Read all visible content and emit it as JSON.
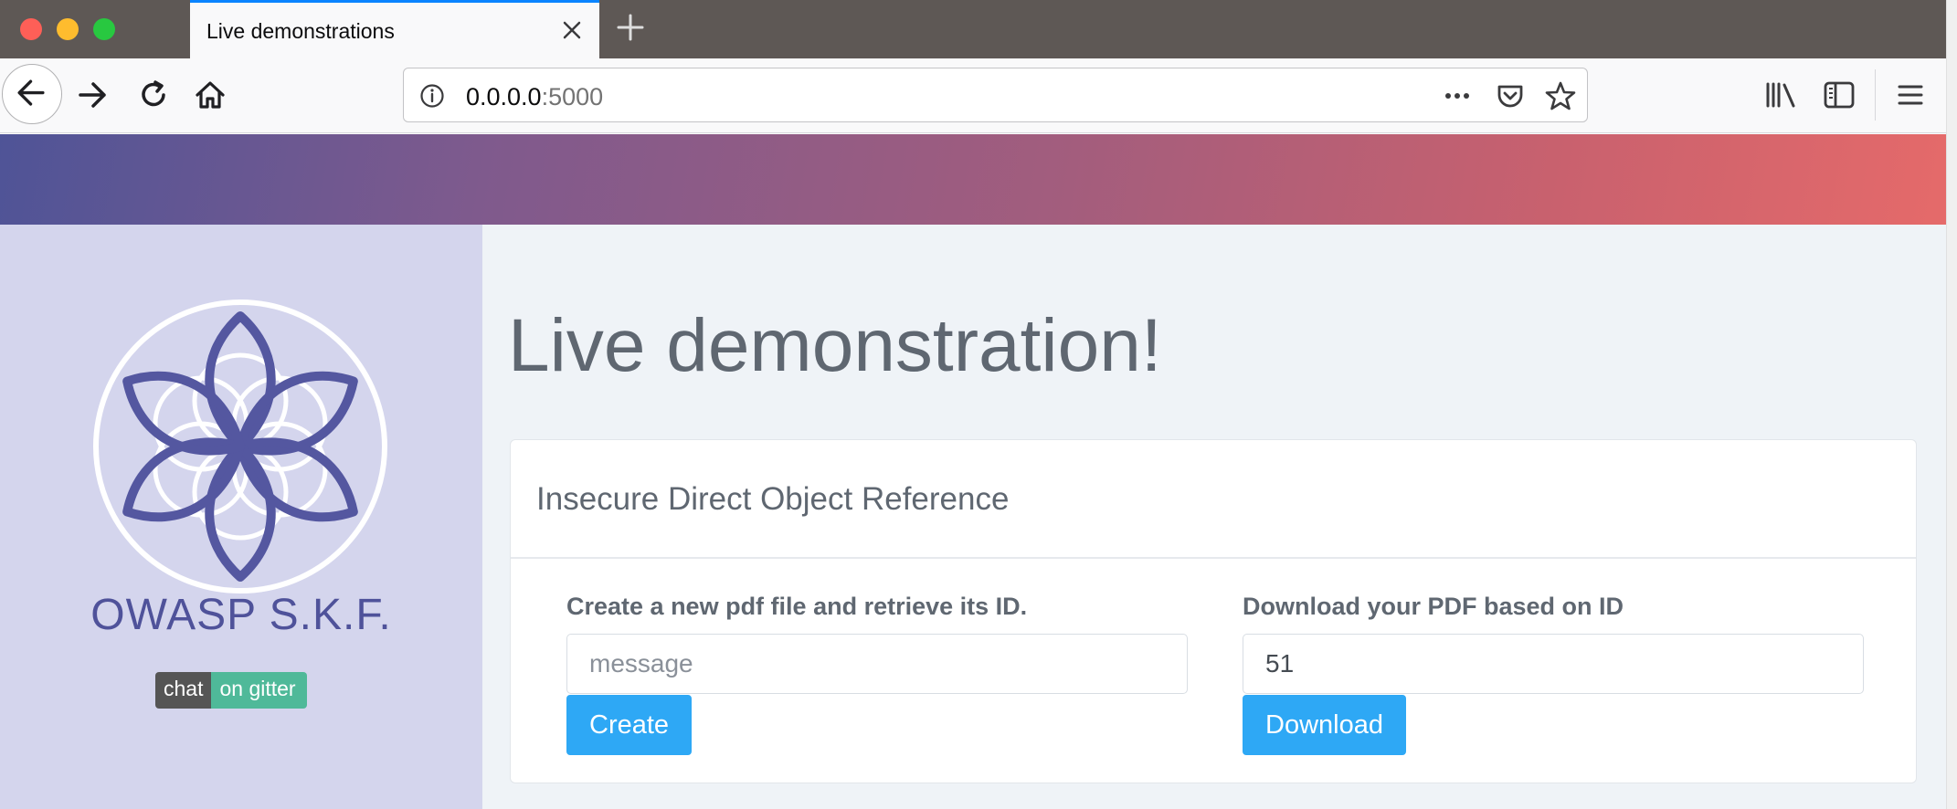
{
  "browser": {
    "tab_title": "Live demonstrations",
    "url_host": "0.0.0.0",
    "url_port": ":5000",
    "accent": "#0a84ff"
  },
  "icons": [
    "close-icon",
    "plus-icon",
    "back-arrow-icon",
    "forward-arrow-icon",
    "reload-icon",
    "home-icon",
    "info-icon",
    "more-dots-icon",
    "pocket-icon",
    "star-icon",
    "library-icon",
    "sidebar-icon",
    "hamburger-menu-icon",
    "owasp-skf-logo"
  ],
  "sidebar": {
    "brand": "OWASP S.K.F.",
    "badge_left": "chat",
    "badge_right": "on gitter",
    "badge_colors": {
      "left": "#555555",
      "right": "#4fb999"
    }
  },
  "main": {
    "title": "Live demonstration!",
    "card_title": "Insecure Direct Object Reference",
    "create": {
      "label": "Create a new pdf file and retrieve its ID.",
      "placeholder": "message",
      "value": "",
      "button": "Create"
    },
    "download": {
      "label": "Download your PDF based on ID",
      "value": "51",
      "button": "Download"
    },
    "button_color": "#2ea8f5"
  }
}
